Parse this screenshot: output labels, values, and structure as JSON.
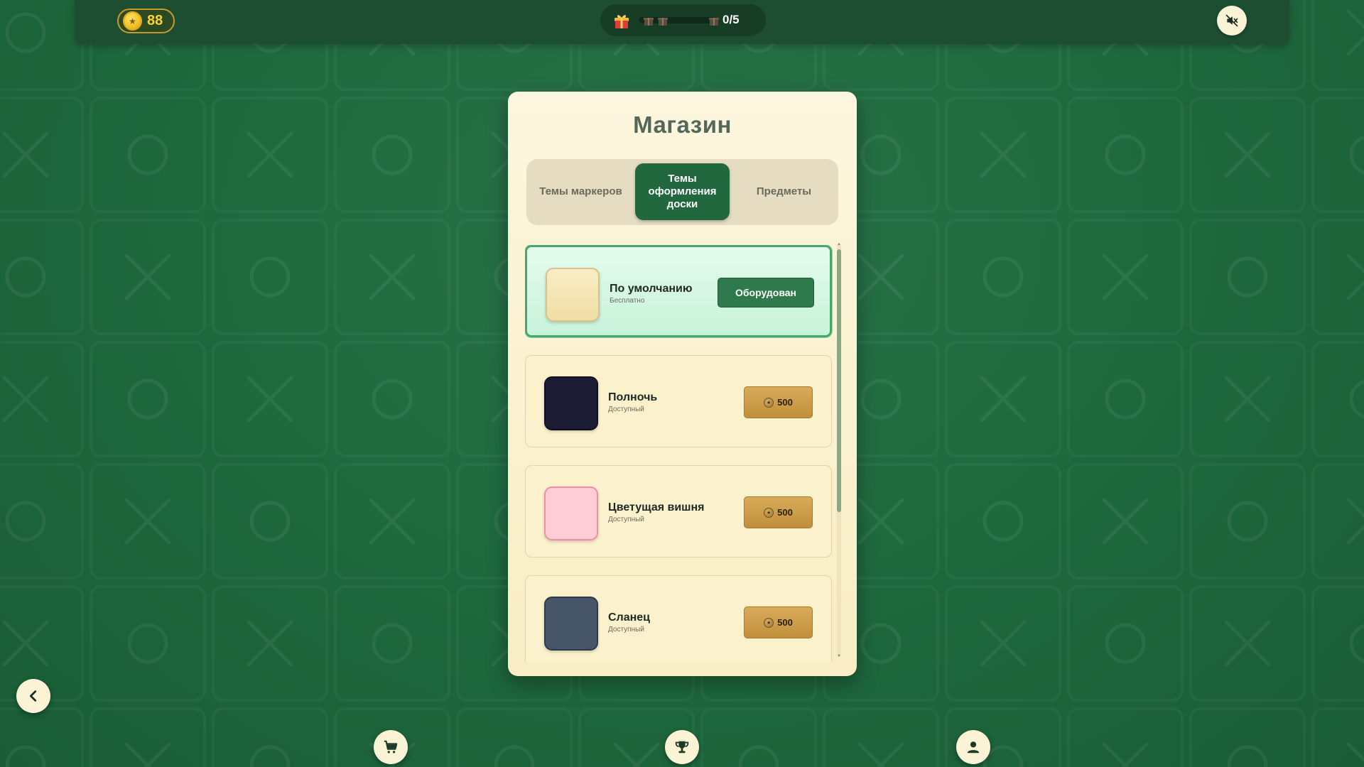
{
  "header": {
    "coins": "88",
    "gift_progress": "0/5",
    "mute_icon": "speaker-muted-icon"
  },
  "shop": {
    "title": "Магазин",
    "tabs": [
      {
        "label": "Темы маркеров",
        "active": false
      },
      {
        "label": "Темы оформления доски",
        "active": true
      },
      {
        "label": "Предметы",
        "active": false
      }
    ],
    "items": [
      {
        "name": "По умолчанию",
        "status": "Бесплатно",
        "color": "#f4e6b6",
        "border": "#d8c28b",
        "equipped": true,
        "button_label": "Оборудован"
      },
      {
        "name": "Полночь",
        "status": "Доступный",
        "color": "#1b1c33",
        "border": "#0f1020",
        "equipped": false,
        "price": "500"
      },
      {
        "name": "Цветущая вишня",
        "status": "Доступный",
        "color": "#fecdd6",
        "border": "#ef8fa6",
        "equipped": false,
        "price": "500"
      },
      {
        "name": "Сланец",
        "status": "Доступный",
        "color": "#475569",
        "border": "#2e3a4a",
        "equipped": false,
        "price": "500"
      }
    ]
  },
  "nav": {
    "back_icon": "chevron-left-icon",
    "shop_icon": "shopping-cart-icon",
    "trophy_icon": "trophy-icon",
    "profile_icon": "user-icon"
  },
  "colors": {
    "background": "#1f6a3f",
    "accent": "#21683f",
    "gold": "#c08f3b",
    "panel": "#fbf3d6"
  }
}
